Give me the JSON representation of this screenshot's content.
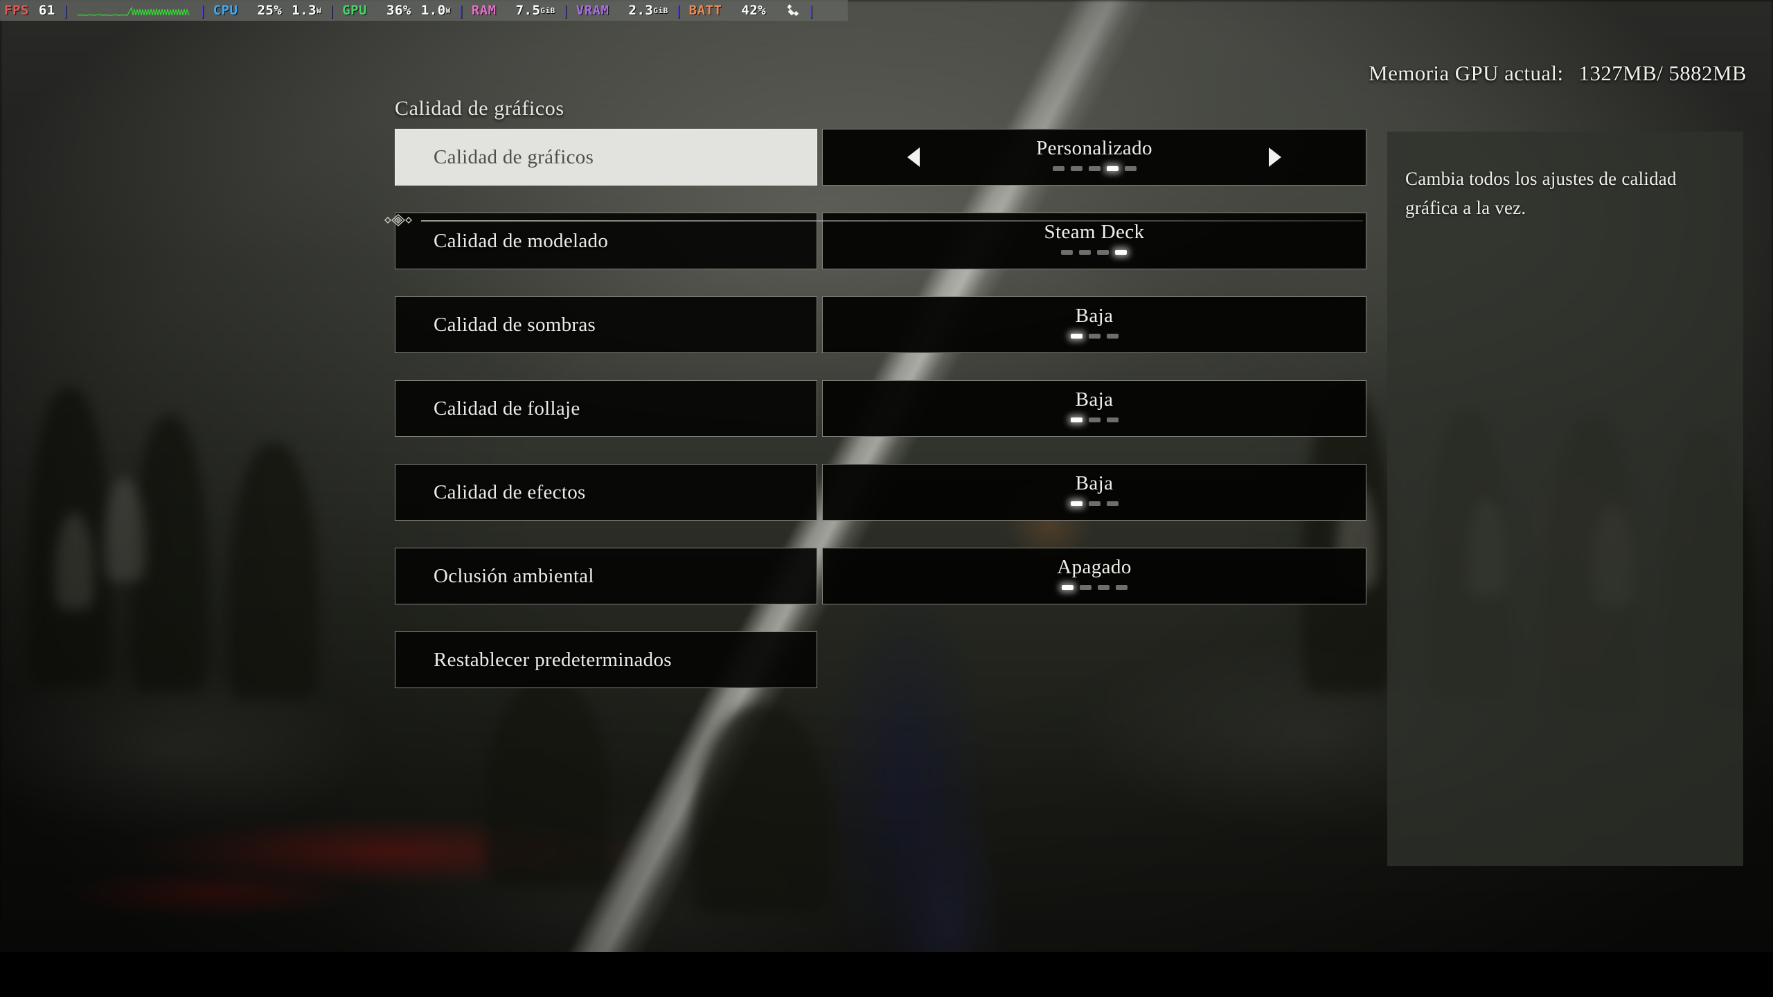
{
  "perf_overlay": {
    "fps_label": "FPS",
    "fps_value": "61",
    "graph_icon": "fps-graph-icon",
    "cpu_label": "CPU",
    "cpu_usage": "25%",
    "cpu_clock": "1.3",
    "cpu_clock_unit": "W",
    "gpu_label": "GPU",
    "gpu_usage": "36%",
    "gpu_clock": "1.0",
    "gpu_clock_unit": "W",
    "ram_label": "RAM",
    "ram_value": "7.5",
    "ram_unit": "GiB",
    "vram_label": "VRAM",
    "vram_value": "2.3",
    "vram_unit": "GiB",
    "batt_label": "BATT",
    "batt_value": "42%",
    "charging_icon": "plug-charging-icon",
    "colors": {
      "fps": "#e05a5a",
      "cpu": "#3fa9f5",
      "gpu": "#4ad36a",
      "ram": "#e36fc8",
      "vram": "#a96fe0",
      "batt": "#e78a5a",
      "graph": "#2fdd2f",
      "separator": "#4d4dbb",
      "background": "#626460"
    }
  },
  "gpu_memory": {
    "label": "Memoria GPU actual:",
    "value": "1327MB/ 5882MB"
  },
  "section": {
    "title": "Calidad de gráficos"
  },
  "settings": {
    "rows": [
      {
        "label": "Calidad de gráficos",
        "value": "Personalizado",
        "selected": true,
        "has_arrows": true,
        "dots_total": 5,
        "dots_active": 4,
        "left_arrow_icon": "chevron-left-icon",
        "right_arrow_icon": "chevron-right-icon"
      },
      {
        "label": "Calidad de modelado",
        "value": "Steam Deck",
        "selected": false,
        "has_arrows": false,
        "dots_total": 4,
        "dots_active": 4
      },
      {
        "label": "Calidad de sombras",
        "value": "Baja",
        "selected": false,
        "has_arrows": false,
        "dots_total": 3,
        "dots_active": 1
      },
      {
        "label": "Calidad de follaje",
        "value": "Baja",
        "selected": false,
        "has_arrows": false,
        "dots_total": 3,
        "dots_active": 1
      },
      {
        "label": "Calidad de efectos",
        "value": "Baja",
        "selected": false,
        "has_arrows": false,
        "dots_total": 3,
        "dots_active": 1
      },
      {
        "label": "Oclusión ambiental",
        "value": "Apagado",
        "selected": false,
        "has_arrows": false,
        "dots_total": 4,
        "dots_active": 1
      }
    ],
    "reset_label": "Restablecer predeterminados"
  },
  "description": {
    "text": "Cambia todos los ajustes de calidad gráfica a la vez."
  },
  "scrollbar": {
    "ornament_icon": "diamond-ornament-icon"
  },
  "theme": {
    "selected_row_bg": "#e2e2de",
    "selected_row_text": "#4e4e4a",
    "row_bg": "#050504",
    "row_border": "#cdcdc6",
    "text": "#ecece6",
    "panel_bg": "#30322c"
  }
}
